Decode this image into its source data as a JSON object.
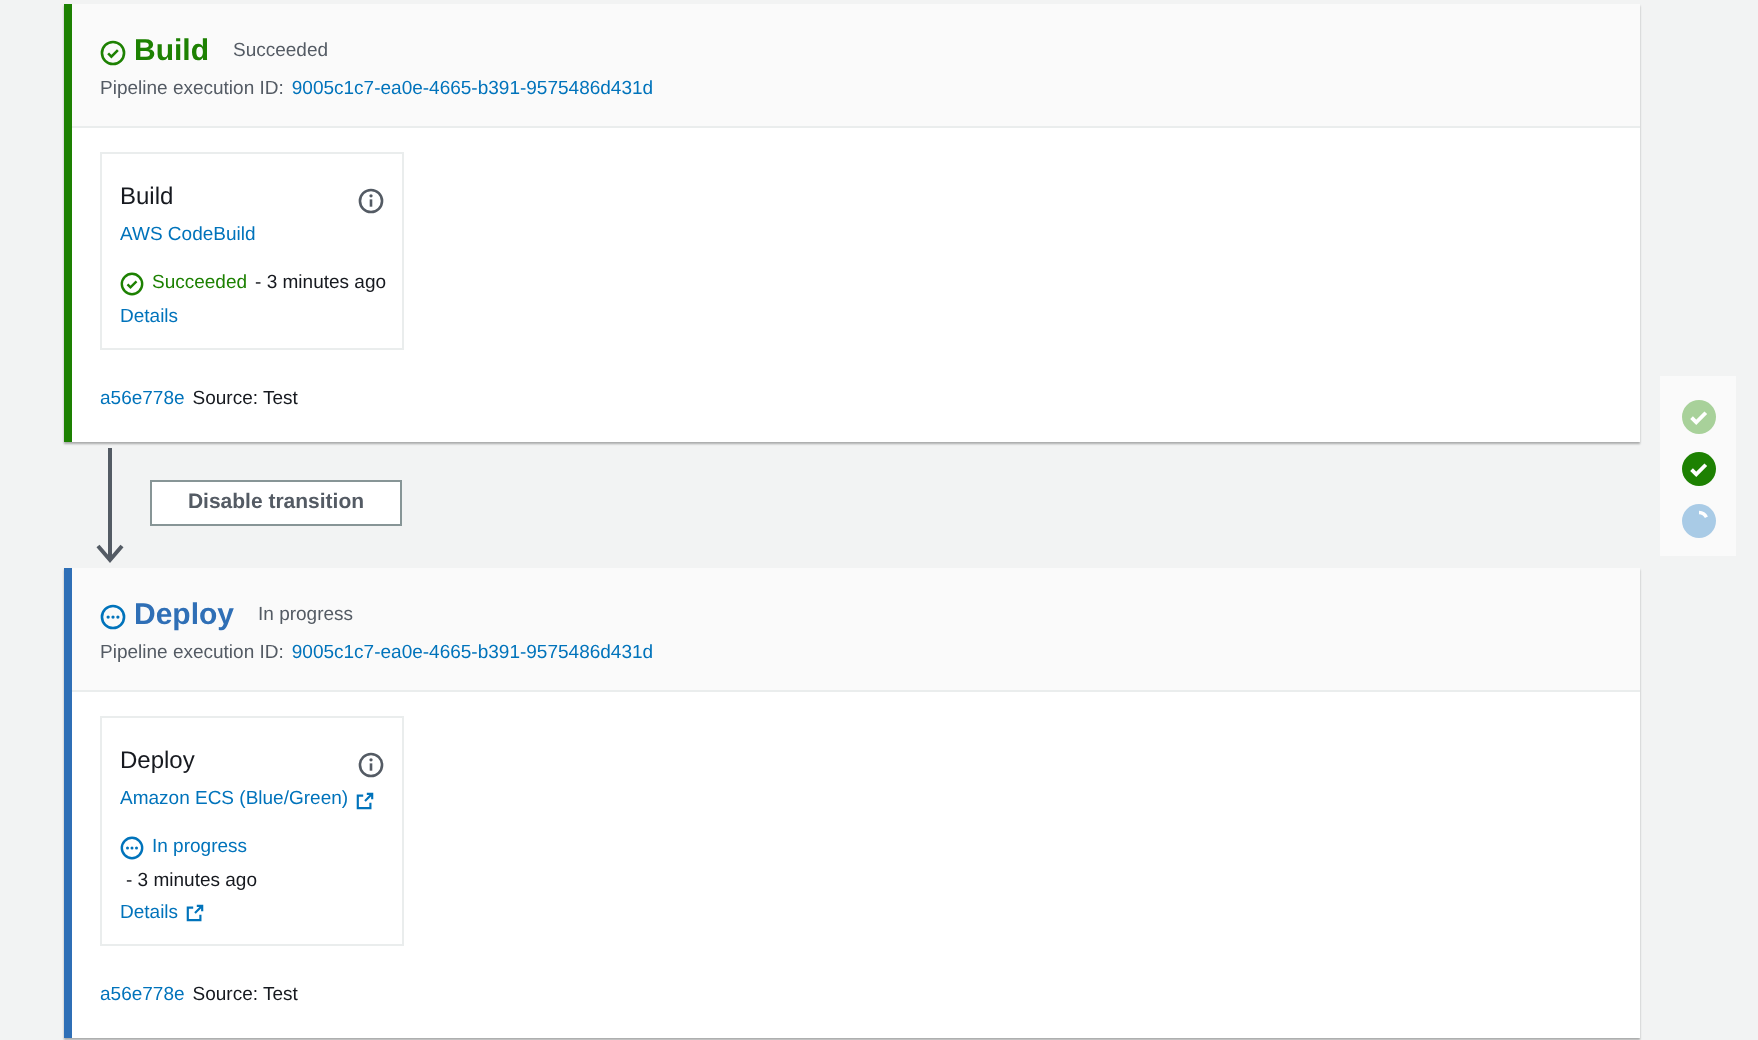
{
  "stages": [
    {
      "name": "Build",
      "kind": "succeeded",
      "status_text": "Succeeded",
      "execution_label": "Pipeline execution ID:",
      "execution_id": "9005c1c7-ea0e-4665-b391-9575486d431d",
      "actions": [
        {
          "name": "Build",
          "provider": "AWS CodeBuild",
          "external_link": false,
          "kind": "succeeded",
          "status_text": "Succeeded",
          "time": "- 3 minutes ago",
          "details": "Details",
          "details_external": false
        }
      ],
      "revision": "a56e778e",
      "source": "Source: Test"
    },
    {
      "name": "Deploy",
      "kind": "in_progress",
      "status_text": "In progress",
      "execution_label": "Pipeline execution ID:",
      "execution_id": "9005c1c7-ea0e-4665-b391-9575486d431d",
      "actions": [
        {
          "name": "Deploy",
          "provider": "Amazon ECS (Blue/Green)",
          "external_link": true,
          "kind": "in_progress",
          "status_text": "In progress",
          "time": "- 3 minutes ago",
          "details": "Details",
          "details_external": true
        }
      ],
      "revision": "a56e778e",
      "source": "Source: Test"
    }
  ],
  "transition": {
    "button": "Disable transition"
  },
  "overview": [
    {
      "kind": "succeeded_faded"
    },
    {
      "kind": "succeeded"
    },
    {
      "kind": "in_progress"
    }
  ]
}
